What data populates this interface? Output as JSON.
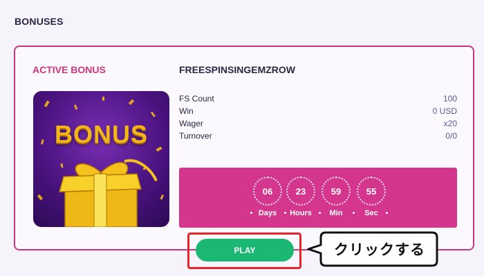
{
  "header": {
    "title": "BONUSES"
  },
  "card": {
    "status_label": "ACTIVE BONUS",
    "bonus_name": "FREESPINSINGEMZROW",
    "image": {
      "word": "BONUS",
      "icon": "gift-box-icon"
    },
    "stats": [
      {
        "label": "FS Count",
        "value": "100"
      },
      {
        "label": "Win",
        "value": "0 USD"
      },
      {
        "label": "Wager",
        "value": "x20"
      },
      {
        "label": "Turnover",
        "value": "0/0"
      }
    ],
    "countdown": {
      "days": {
        "value": "06",
        "label": "Days"
      },
      "hours": {
        "value": "23",
        "label": "Hours"
      },
      "min": {
        "value": "59",
        "label": "Min"
      },
      "sec": {
        "value": "55",
        "label": "Sec"
      }
    },
    "play_label": "PLAY"
  },
  "annotation": {
    "callout_text": "クリックする"
  },
  "colors": {
    "accent": "#c8357f",
    "timer_bg": "#d3368c",
    "play": "#1bb874",
    "highlight": "#e8232a"
  }
}
